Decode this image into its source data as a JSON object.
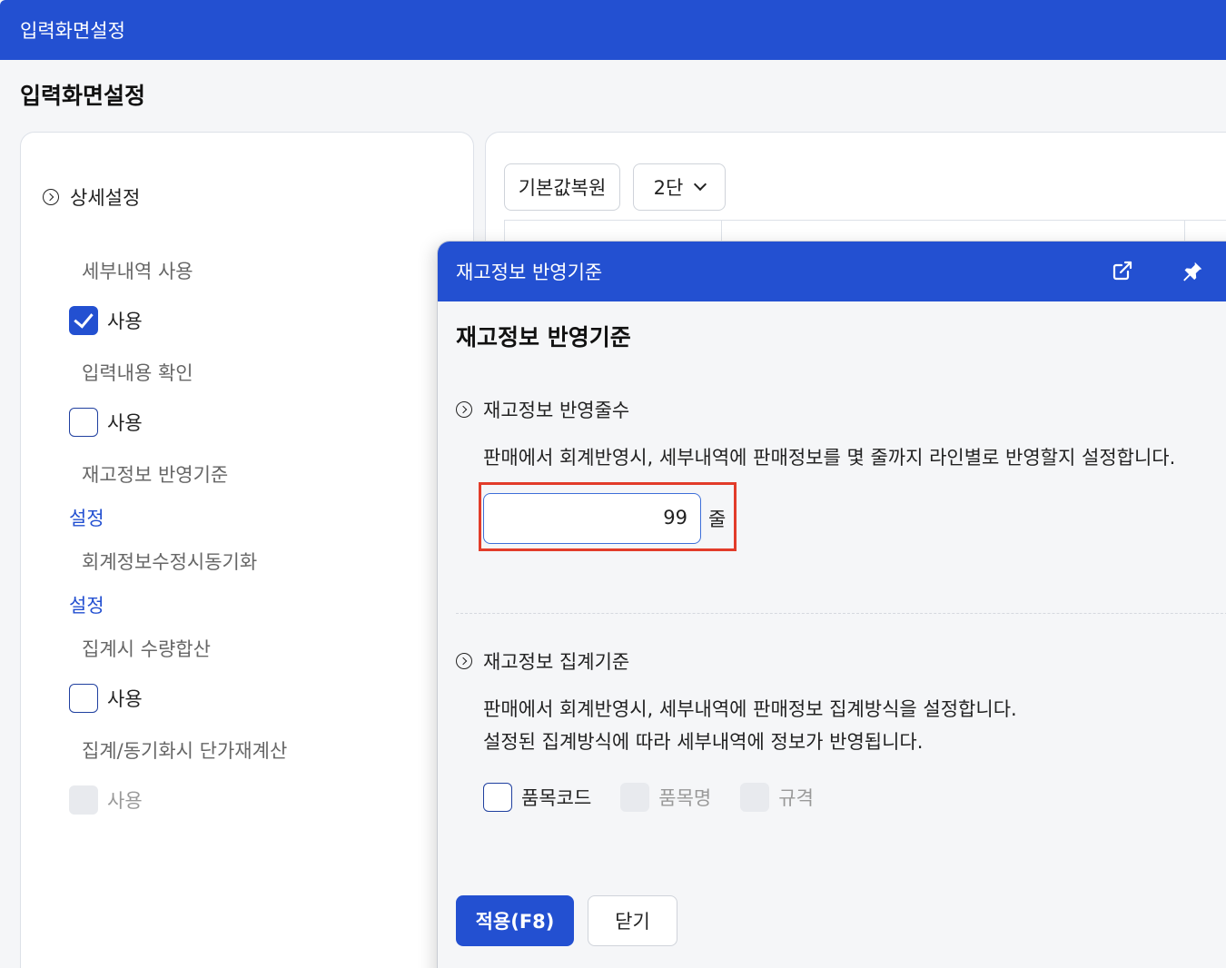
{
  "window": {
    "title": "입력화면설정"
  },
  "page": {
    "title": "입력화면설정"
  },
  "left": {
    "section_title": "상세설정",
    "rows": [
      {
        "label": "세부내역 사용",
        "control": "checkbox",
        "text": "사용",
        "checked": true
      },
      {
        "label": "입력내용 확인",
        "control": "checkbox",
        "text": "사용",
        "checked": false
      },
      {
        "label": "재고정보 반영기준",
        "control": "link",
        "text": "설정"
      },
      {
        "label": "회계정보수정시동기화",
        "control": "link",
        "text": "설정"
      },
      {
        "label": "집계시 수량합산",
        "control": "checkbox",
        "text": "사용",
        "checked": false
      },
      {
        "label": "집계/동기화시 단가재계산",
        "control": "checkbox",
        "text": "사용",
        "checked": false,
        "disabled": true
      }
    ]
  },
  "right": {
    "restore_button": "기본값복원",
    "columns_select": "2단"
  },
  "modal": {
    "header_title": "재고정보 반영기준",
    "title": "재고정보 반영기준",
    "section1": {
      "title": "재고정보 반영줄수",
      "description": "판매에서 회계반영시, 세부내역에 판매정보를 몇 줄까지 라인별로 반영할지 설정합니다.",
      "input_value": "99",
      "unit": "줄"
    },
    "section2": {
      "title": "재고정보 집계기준",
      "description_line1": "판매에서 회계반영시, 세부내역에 판매정보 집계방식을 설정합니다.",
      "description_line2": "설정된 집계방식에 따라 세부내역에 정보가 반영됩니다.",
      "options": [
        {
          "label": "품목코드",
          "checked": false,
          "disabled": false
        },
        {
          "label": "품목명",
          "checked": false,
          "disabled": true
        },
        {
          "label": "규격",
          "checked": false,
          "disabled": true
        }
      ]
    },
    "apply_button": "적용(F8)",
    "close_button": "닫기"
  },
  "colors": {
    "primary": "#2350d1",
    "highlight": "#e23c2a"
  }
}
